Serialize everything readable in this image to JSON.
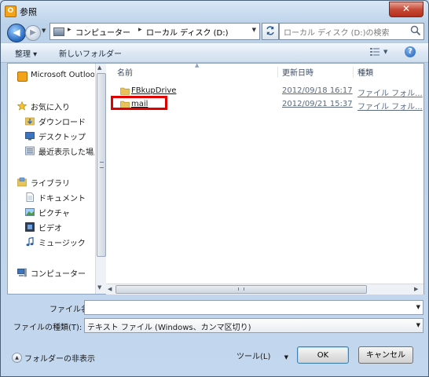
{
  "window": {
    "title": "参照",
    "app_icon_letter": "O",
    "close_symbol": "✕"
  },
  "address": {
    "crumbs": [
      "コンピューター",
      "ローカル ディスク (D:)"
    ],
    "search_placeholder": "ローカル ディスク (D:)の検索"
  },
  "toolbar": {
    "organize": "整理 ▾",
    "new_folder": "新しいフォルダー",
    "help": "?"
  },
  "nav": {
    "items": [
      {
        "label": "Microsoft Outlook",
        "icon": "outlook-icon"
      },
      {
        "label": "お気に入り",
        "icon": "star-icon"
      },
      {
        "label": "ダウンロード",
        "icon": "download-folder-icon"
      },
      {
        "label": "デスクトップ",
        "icon": "desktop-icon"
      },
      {
        "label": "最近表示した場所",
        "icon": "recent-places-icon"
      },
      {
        "label": "ライブラリ",
        "icon": "library-icon"
      },
      {
        "label": "ドキュメント",
        "icon": "document-icon"
      },
      {
        "label": "ピクチャ",
        "icon": "picture-icon"
      },
      {
        "label": "ビデオ",
        "icon": "video-icon"
      },
      {
        "label": "ミュージック",
        "icon": "music-icon"
      },
      {
        "label": "コンピューター",
        "icon": "computer-icon"
      }
    ]
  },
  "files": {
    "columns": {
      "name": "名前",
      "modified": "更新日時",
      "type": "種類"
    },
    "rows": [
      {
        "name": "FBkupDrive",
        "modified": "2012/09/18 16:17",
        "type": "ファイル フォル..."
      },
      {
        "name": "mail",
        "modified": "2012/09/21 15:37",
        "type": "ファイル フォル..."
      }
    ]
  },
  "form": {
    "filename_label": "ファイル名(N):",
    "filename_value": "",
    "filetype_label": "ファイルの種類(T):",
    "filetype_value": "テキスト ファイル (Windows、カンマ区切り)"
  },
  "footer": {
    "hide_folders": "フォルダーの非表示",
    "tools": "ツール(L)",
    "ok": "OK",
    "cancel": "キャンセル"
  },
  "colors": {
    "highlight": "#e00000",
    "folder": "#e8c25a"
  }
}
